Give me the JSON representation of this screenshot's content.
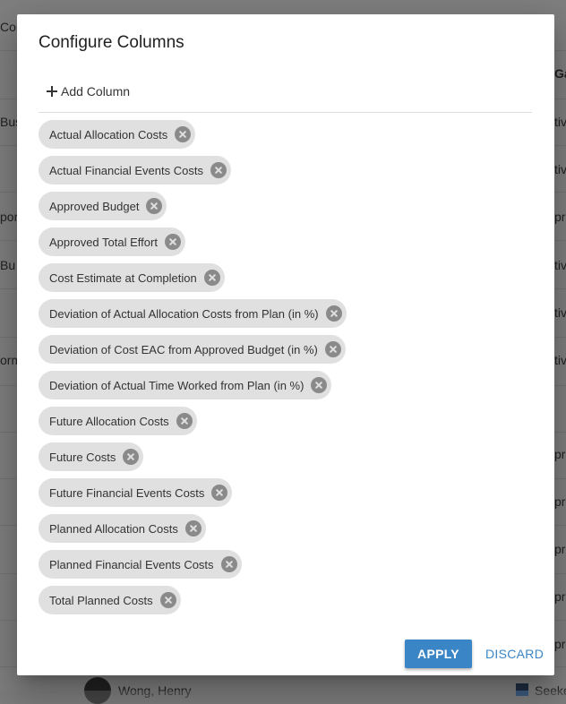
{
  "background": {
    "left_fragments": [
      "Configu",
      "Bus",
      "port",
      "Bu",
      "orm"
    ],
    "right_fragments": [
      "Ga",
      "tive",
      "tive",
      "prop",
      "tive",
      "tive",
      "tive",
      "prop",
      "prop",
      "prop",
      "prop",
      "prop"
    ],
    "bottom_person": "Wong, Henry",
    "bottom_right": "Seeke"
  },
  "dialog": {
    "title": "Configure Columns",
    "add_column_label": "Add Column",
    "chips": [
      "Actual Allocation Costs",
      "Actual Financial Events Costs",
      "Approved Budget",
      "Approved Total Effort",
      "Cost Estimate at Completion",
      "Deviation of Actual Allocation Costs from Plan (in %)",
      "Deviation of Cost EAC from Approved Budget (in %)",
      "Deviation of Actual Time Worked from Plan (in %)",
      "Future Allocation Costs",
      "Future Costs",
      "Future Financial Events Costs",
      "Planned Allocation Costs",
      "Planned Financial Events Costs",
      "Total Planned Costs"
    ],
    "apply_label": "APPLY",
    "discard_label": "DISCARD"
  },
  "colors": {
    "primary": "#3a85c6",
    "chip_bg": "#e0e0e0",
    "chip_remove": "#8a8a8a"
  }
}
